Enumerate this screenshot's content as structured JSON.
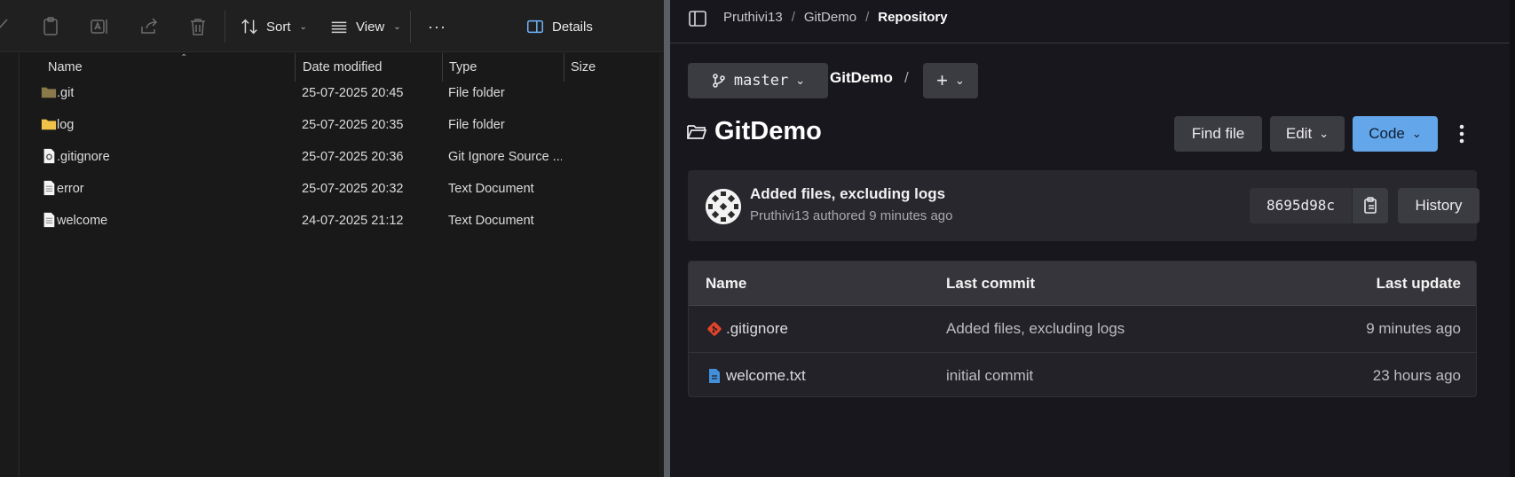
{
  "explorer": {
    "toolbar": {
      "sort_label": "Sort",
      "view_label": "View",
      "more_label": "···",
      "details_label": "Details"
    },
    "columns": {
      "name": "Name",
      "date": "Date modified",
      "type": "Type",
      "size": "Size"
    },
    "files": [
      {
        "name": ".git",
        "date": "25-07-2025 20:45",
        "type": "File folder",
        "icon": "folder-icon"
      },
      {
        "name": "log",
        "date": "25-07-2025 20:35",
        "type": "File folder",
        "icon": "folder-icon"
      },
      {
        "name": ".gitignore",
        "date": "25-07-2025 20:36",
        "type": "Git Ignore Source ...",
        "icon": "gear-file-icon"
      },
      {
        "name": "error",
        "date": "25-07-2025 20:32",
        "type": "Text Document",
        "icon": "text-file-icon"
      },
      {
        "name": "welcome",
        "date": "24-07-2025 21:12",
        "type": "Text Document",
        "icon": "text-file-icon"
      }
    ]
  },
  "repo": {
    "breadcrumb": {
      "owner": "Pruthivi13",
      "project": "GitDemo",
      "current": "Repository"
    },
    "branch": "master",
    "path_root": "GitDemo",
    "path_sep": "/",
    "title": "GitDemo",
    "buttons": {
      "find_file": "Find file",
      "edit": "Edit",
      "code": "Code",
      "history": "History"
    },
    "last_commit": {
      "message": "Added files, excluding logs",
      "author": "Pruthivi13",
      "meta_suffix": "authored 9 minutes ago",
      "sha": "8695d98c"
    },
    "table": {
      "headers": {
        "name": "Name",
        "last_commit": "Last commit",
        "last_update": "Last update"
      },
      "rows": [
        {
          "name": ".gitignore",
          "last_commit": "Added files, excluding logs",
          "last_update": "9 minutes ago",
          "icon": "git-icon"
        },
        {
          "name": "welcome.txt",
          "last_commit": "initial commit",
          "last_update": "23 hours ago",
          "icon": "document-icon"
        }
      ]
    },
    "colors": {
      "accent": "#63a6e9",
      "git_orange": "#e24329"
    }
  }
}
